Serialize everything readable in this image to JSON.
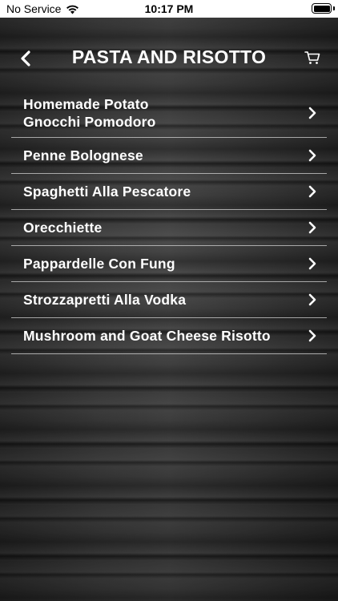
{
  "status_bar": {
    "carrier": "No Service",
    "time": "10:17 PM"
  },
  "header": {
    "title": "PASTA AND RISOTTO",
    "back_icon": "chevron-left-icon",
    "cart_icon": "cart-icon"
  },
  "menu": {
    "items": [
      {
        "line1": "Homemade Potato",
        "line2": "Gnocchi Pomodoro"
      },
      {
        "label": "Penne Bolognese"
      },
      {
        "label": "Spaghetti Alla Pescatore"
      },
      {
        "label": "Orecchiette"
      },
      {
        "label": "Pappardelle Con Fung"
      },
      {
        "label": "Strozzapretti Alla Vodka"
      },
      {
        "label": "Mushroom and Goat Cheese Risotto"
      }
    ]
  },
  "colors": {
    "text": "#ffffff",
    "divider": "#d2d2d2",
    "background": "#3a3a3a",
    "status_bar": "#ffffff"
  }
}
